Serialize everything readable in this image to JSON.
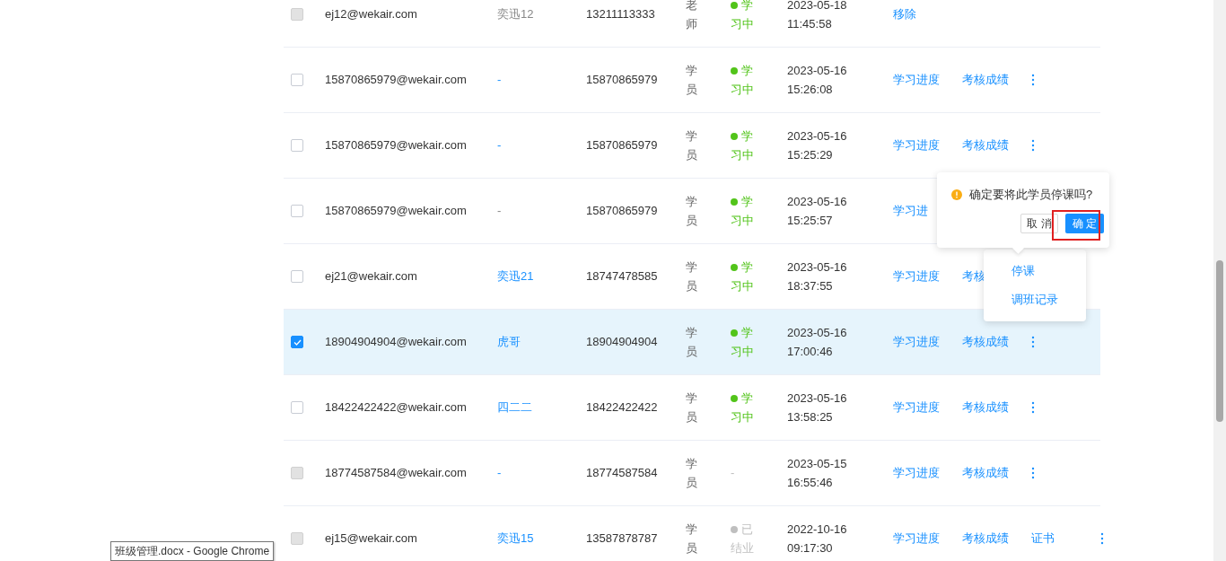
{
  "rows": [
    {
      "checkbox": {
        "checked": false,
        "disabled": true
      },
      "selected": false,
      "email": "ej12@wekair.com",
      "nickname": {
        "text": "奕迅12",
        "kind": "plain"
      },
      "phone": "13211113333",
      "role": "老师",
      "status": {
        "kind": "active",
        "text": "学习中"
      },
      "date": "2023-05-18",
      "time": "11:45:58",
      "actions": [
        "移除"
      ],
      "more": false
    },
    {
      "checkbox": {
        "checked": false,
        "disabled": false
      },
      "selected": false,
      "email": "15870865979@wekair.com",
      "nickname": {
        "text": "-",
        "kind": "link"
      },
      "phone": "15870865979",
      "role": "学员",
      "status": {
        "kind": "active",
        "text": "学习中"
      },
      "date": "2023-05-16",
      "time": "15:26:08",
      "actions": [
        "学习进度",
        "考核成绩"
      ],
      "more": true
    },
    {
      "checkbox": {
        "checked": false,
        "disabled": false
      },
      "selected": false,
      "email": "15870865979@wekair.com",
      "nickname": {
        "text": "-",
        "kind": "link"
      },
      "phone": "15870865979",
      "role": "学员",
      "status": {
        "kind": "active",
        "text": "学习中"
      },
      "date": "2023-05-16",
      "time": "15:25:29",
      "actions": [
        "学习进度",
        "考核成绩"
      ],
      "more": true
    },
    {
      "checkbox": {
        "checked": false,
        "disabled": false
      },
      "selected": false,
      "email": "15870865979@wekair.com",
      "nickname": {
        "text": "-",
        "kind": "plain"
      },
      "phone": "15870865979",
      "role": "学员",
      "status": {
        "kind": "active",
        "text": "学习中"
      },
      "date": "2023-05-16",
      "time": "15:25:57",
      "actions": [
        "学习进"
      ],
      "more": false
    },
    {
      "checkbox": {
        "checked": false,
        "disabled": false
      },
      "selected": false,
      "email": "ej21@wekair.com",
      "nickname": {
        "text": "奕迅21",
        "kind": "link"
      },
      "phone": "18747478585",
      "role": "学员",
      "status": {
        "kind": "active",
        "text": "学习中"
      },
      "date": "2023-05-16",
      "time": "18:37:55",
      "actions": [
        "学习进度",
        "考核"
      ],
      "more": false
    },
    {
      "checkbox": {
        "checked": true,
        "disabled": false
      },
      "selected": true,
      "email": "18904904904@wekair.com",
      "nickname": {
        "text": "虎哥",
        "kind": "link"
      },
      "phone": "18904904904",
      "role": "学员",
      "status": {
        "kind": "active",
        "text": "学习中"
      },
      "date": "2023-05-16",
      "time": "17:00:46",
      "actions": [
        "学习进度",
        "考核成绩"
      ],
      "more": true
    },
    {
      "checkbox": {
        "checked": false,
        "disabled": false
      },
      "selected": false,
      "email": "18422422422@wekair.com",
      "nickname": {
        "text": "四二二",
        "kind": "link"
      },
      "phone": "18422422422",
      "role": "学员",
      "status": {
        "kind": "active",
        "text": "学习中"
      },
      "date": "2023-05-16",
      "time": "13:58:25",
      "actions": [
        "学习进度",
        "考核成绩"
      ],
      "more": true
    },
    {
      "checkbox": {
        "checked": false,
        "disabled": true
      },
      "selected": false,
      "email": "18774587584@wekair.com",
      "nickname": {
        "text": "-",
        "kind": "link"
      },
      "phone": "18774587584",
      "role": "学员",
      "status": {
        "kind": "none",
        "text": "-"
      },
      "date": "2023-05-15",
      "time": "16:55:46",
      "actions": [
        "学习进度",
        "考核成绩"
      ],
      "more": true
    },
    {
      "checkbox": {
        "checked": false,
        "disabled": true
      },
      "selected": false,
      "email": "ej15@wekair.com",
      "nickname": {
        "text": "奕迅15",
        "kind": "link"
      },
      "phone": "13587878787",
      "role": "学员",
      "status": {
        "kind": "finished",
        "text": "已结业"
      },
      "date": "2022-10-16",
      "time": "09:17:30",
      "actions": [
        "学习进度",
        "考核成绩",
        "证书"
      ],
      "more": true
    }
  ],
  "popconfirm": {
    "message": "确定要将此学员停课吗?",
    "cancel": "取 消",
    "confirm": "确 定"
  },
  "menu": {
    "items": [
      "停课",
      "调班记录"
    ]
  },
  "tooltip": "班级管理.docx - Google Chrome"
}
